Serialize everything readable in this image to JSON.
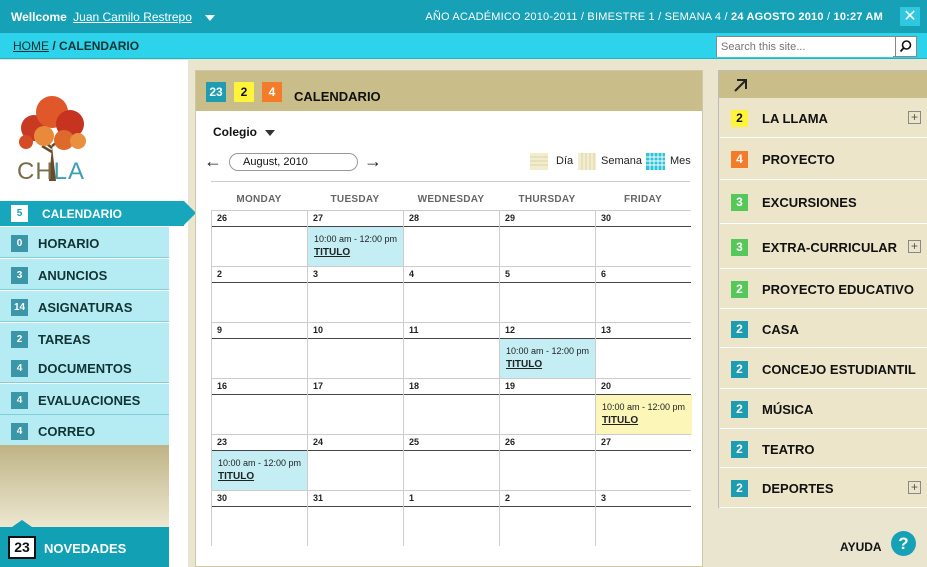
{
  "topbar": {
    "welcome": "Wellcome",
    "user": "Juan Camilo Restrepo",
    "info_prefix": "AÑO ACADÉMICO 2010-2011  /  BIMESTRE 1  /  SEMANA 4  /",
    "info_date": "24 AGOSTO 2010",
    "info_sep": "/",
    "info_time": "10:27 AM",
    "close_label": "✕"
  },
  "breadcrumb": {
    "home": "HOME",
    "sep": "/",
    "current": "CALENDARIO"
  },
  "search": {
    "placeholder": "Search this site..."
  },
  "logo": {
    "text_ch": "CH",
    "text_la": "LA"
  },
  "nav": {
    "active": {
      "count": "5",
      "label": "CALENDARIO"
    },
    "items": [
      {
        "count": "0",
        "label": "HORARIO"
      },
      {
        "count": "3",
        "label": "ANUNCIOS"
      },
      {
        "count": "14",
        "label": "ASIGNATURAS"
      },
      {
        "count": "2",
        "label": "TAREAS"
      },
      {
        "count": "4",
        "label": "DOCUMENTOS"
      },
      {
        "count": "4",
        "label": "EVALUACIONES"
      },
      {
        "count": "4",
        "label": "CORREO"
      }
    ]
  },
  "novedades": {
    "count": "23",
    "label": "NOVEDADES"
  },
  "calendar": {
    "badges": [
      {
        "value": "23",
        "bg": "#1e9cb1",
        "fg": "#ffffff"
      },
      {
        "value": "2",
        "bg": "#fff43a",
        "fg": "#111111"
      },
      {
        "value": "4",
        "bg": "#f47b2a",
        "fg": "#ffffff"
      }
    ],
    "title": "CALENDARIO",
    "filter": "Colegio",
    "prev": "←",
    "next": "→",
    "month": "August, 2010",
    "views": [
      "Día",
      "Semana",
      "Mes"
    ],
    "days": [
      "MONDAY",
      "TUESDAY",
      "WEDNESDAY",
      "THURSDAY",
      "FRIDAY"
    ],
    "weeks": [
      [
        "26",
        "27",
        "28",
        "29",
        "30"
      ],
      [
        "2",
        "3",
        "4",
        "5",
        "6"
      ],
      [
        "9",
        "10",
        "11",
        "12",
        "13"
      ],
      [
        "16",
        "17",
        "18",
        "19",
        "20"
      ],
      [
        "23",
        "24",
        "25",
        "26",
        "27"
      ],
      [
        "30",
        "31",
        "1",
        "2",
        "3"
      ]
    ],
    "events": [
      {
        "week": 0,
        "day": 1,
        "time": "10:00 am - 12:00 pm",
        "title": "TITULO",
        "color": "blue"
      },
      {
        "week": 2,
        "day": 3,
        "time": "10:00 am - 12:00 pm",
        "title": "TITULO",
        "color": "blue"
      },
      {
        "week": 3,
        "day": 4,
        "time": "10:00 am - 12:00 pm",
        "title": "TITULO",
        "color": "yellow"
      },
      {
        "week": 4,
        "day": 0,
        "time": "10:00 am - 12:00 pm",
        "title": "TITULO",
        "color": "blue"
      }
    ]
  },
  "right": {
    "items": [
      {
        "count": "2",
        "label": "LA LLAMA",
        "bg": "#fff43a",
        "fg": "#111111",
        "plus": true
      },
      {
        "count": "4",
        "label": "PROYECTO",
        "bg": "#f47b2a",
        "fg": "#ffffff",
        "plus": false
      },
      {
        "count": "3",
        "label": "EXCURSIONES",
        "bg": "#56c85a",
        "fg": "#ffffff",
        "plus": false
      },
      {
        "count": "3",
        "label": "EXTRA-CURRICULAR",
        "bg": "#56c85a",
        "fg": "#ffffff",
        "plus": true
      },
      {
        "count": "2",
        "label": "PROYECTO EDUCATIVO",
        "bg": "#56c85a",
        "fg": "#ffffff",
        "plus": false
      },
      {
        "count": "2",
        "label": "CASA",
        "bg": "#1e9cb1",
        "fg": "#ffffff",
        "plus": false
      },
      {
        "count": "2",
        "label": "CONCEJO ESTUDIANTIL",
        "bg": "#1e9cb1",
        "fg": "#ffffff",
        "plus": false
      },
      {
        "count": "2",
        "label": "MÚSICA",
        "bg": "#1e9cb1",
        "fg": "#ffffff",
        "plus": false
      },
      {
        "count": "2",
        "label": "TEATRO",
        "bg": "#1e9cb1",
        "fg": "#ffffff",
        "plus": false
      },
      {
        "count": "2",
        "label": "DEPORTES",
        "bg": "#1e9cb1",
        "fg": "#ffffff",
        "plus": true
      }
    ],
    "plus_label": "+"
  },
  "help": {
    "label": "AYUDA",
    "icon": "?"
  }
}
